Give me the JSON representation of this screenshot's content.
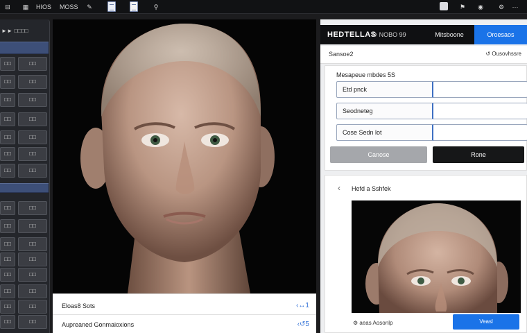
{
  "topbar": {
    "items": [
      "HIOS",
      "MOSS"
    ]
  },
  "left_panel": {
    "header": "►► □□□□",
    "buttons": [
      "□□",
      "□□",
      "□□",
      "□□",
      "□□",
      "□□",
      "□□",
      "□□",
      "□□",
      "□□",
      "□□",
      "□□",
      "□□",
      "□□",
      "□□",
      "□□",
      "□□",
      "□□",
      "□□",
      "□□",
      "□□",
      "□□",
      "□□",
      "□□",
      "□□",
      "□□",
      "□□",
      "□□",
      "□□",
      "□□"
    ]
  },
  "viewport": {
    "rows": [
      {
        "label": "Eloas8 Sots",
        "value": "‹↔1"
      },
      {
        "label": "Aupreaned Gonmaioxions",
        "value": "‹↺5"
      }
    ]
  },
  "right_panel": {
    "tabs": {
      "title": "HEDTELLAS",
      "tab1": "⚙ NOBO 99",
      "tab2": "Mitsboone",
      "active": "Oroesaos"
    },
    "subheader": {
      "left": "Sansoe2",
      "right": "↺ Ousovhssre"
    },
    "form": {
      "title": "Mesapeue mbdes 5S",
      "fields": [
        {
          "label": "Etd pnck",
          "value": ""
        },
        {
          "label": "Seodneteg",
          "value": ""
        },
        {
          "label": "Cose Sedn lot",
          "value": ""
        }
      ],
      "cancel_label": "Canose",
      "done_label": "Rone"
    },
    "preview": {
      "back": "‹",
      "title": "Hefd a Sshfek",
      "footer_label": "⚙ aeas Aosonlp",
      "button_label": "Veasl"
    }
  },
  "colors": {
    "accent": "#1a73e8",
    "panel_bg": "#24262b",
    "strip": "#3d4f78"
  }
}
